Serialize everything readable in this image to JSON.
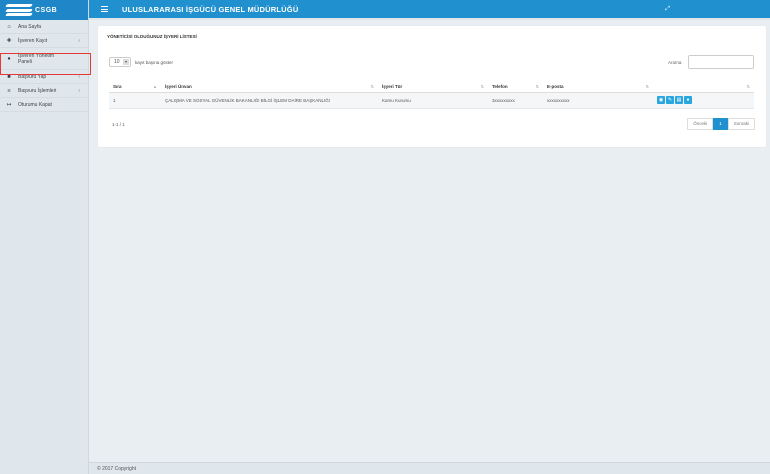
{
  "brand": {
    "name": "CSGB",
    "color": "#2190cf"
  },
  "header": {
    "title": "ULUSLARARASI İŞGÜCÜ GENEL MÜDÜRLÜĞÜ"
  },
  "sidebar": {
    "items": [
      {
        "icon": "home-icon",
        "label": "Ana Sayfa"
      },
      {
        "icon": "register-icon",
        "label": "İşveren Kayıt"
      },
      {
        "icon": "user-icon",
        "label": "İşveren Yönetim Paneli"
      },
      {
        "icon": "briefcase-icon",
        "label": "Başvuru Yap"
      },
      {
        "icon": "list-icon",
        "label": "Başvuru İşlemleri"
      },
      {
        "icon": "logout-icon",
        "label": "Oturumu Kapat"
      }
    ]
  },
  "panel": {
    "title": "YÖNETİCİSİ OLDUĞUNUZ İŞYERİ LİSTESİ",
    "page_length": "10",
    "page_length_label": "kayıt başına göster",
    "search_label": "Arama:",
    "columns": [
      "Sıra",
      "İşyeri Ünvan",
      "İşyeri Tür",
      "Telefon",
      "E-posta",
      ""
    ],
    "rows": [
      {
        "sira": "1",
        "unvan": "ÇALIŞMA VE SOSYAL GÜVENLİK BAKANLIĞI BİLGİ İŞLEM DAİRE BAŞKANLIĞI",
        "tur": "Kamu Kurumu",
        "telefon": "3xxxxxxxxx",
        "eposta": "xxxxxxxxxx"
      }
    ],
    "info": "1-1 / 1",
    "pager": {
      "prev": "Önceki",
      "current": "1",
      "next": "Sonraki"
    }
  },
  "footer": {
    "copyright": "© 2017 Copyright"
  }
}
